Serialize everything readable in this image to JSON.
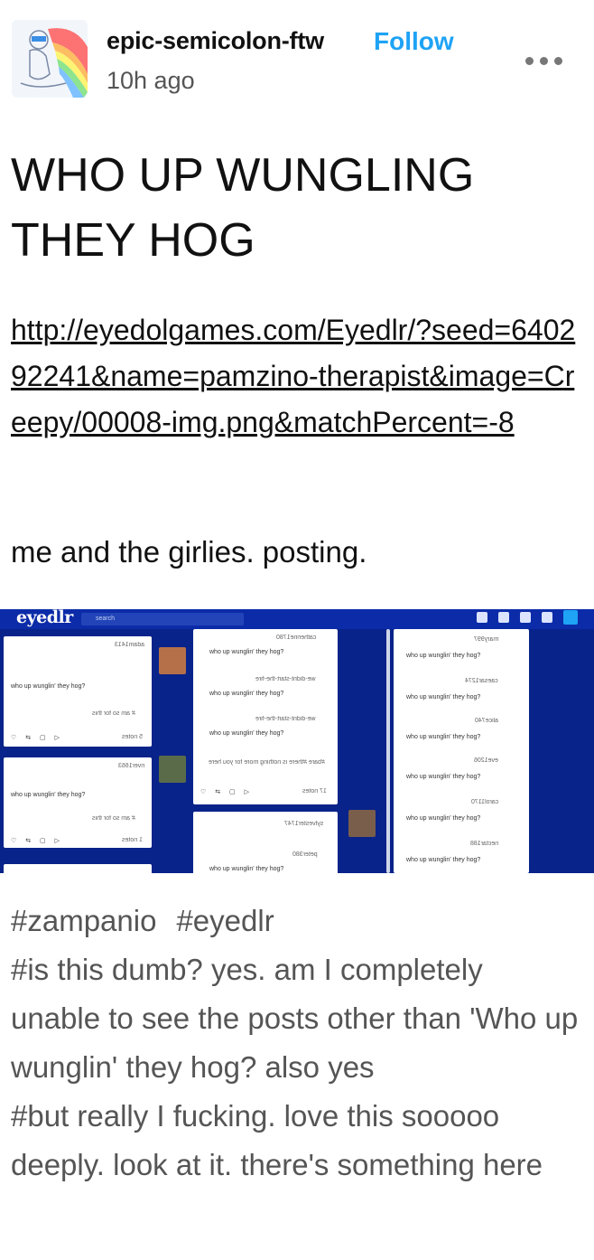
{
  "header": {
    "blog_name": "epic-semicolon-ftw",
    "follow_label": "Follow",
    "timestamp": "10h ago",
    "more_icon": "more-dots-icon"
  },
  "post": {
    "title_line1": "WHO UP WUNGLING",
    "title_line2": "THEY HOG",
    "link_text": "http://eyedolgames.com/Eyedlr/?seed=640292241&name=pamzino-therapist&image=Creepy/00008-img.png&matchPercent=-8",
    "caption": "me and the girlies. posting."
  },
  "screenshot": {
    "logo": "eyedlr",
    "search_placeholder": "search",
    "post_text": "who up wunglin' they hog?",
    "mirrored_tag_text": "# am so for this",
    "mirrored_tag_text2": "#bare #there is nothing more for you here",
    "notes": [
      "5 notes",
      "17 notes",
      "1 notes"
    ],
    "usernames": [
      "adam1413",
      "catherine1780",
      "we-didnt-start-the-fire",
      "river1663",
      "sylvester1747",
      "nectar188",
      "peter380",
      "mary997",
      "caesar1274",
      "alice740",
      "eve1206",
      "carol1170",
      "nectar188"
    ]
  },
  "tags": [
    "#zampanio",
    "#eyedlr",
    "#is this dumb? yes. am I completely unable to see the posts other than 'Who up wunglin' they hog? also yes",
    "#but really I fucking. love this sooooo deeply. look at it. there's something here"
  ],
  "colors": {
    "follow": "#1ea3f5",
    "screenshot_bg": "#08238a",
    "tag_text": "#555555"
  }
}
